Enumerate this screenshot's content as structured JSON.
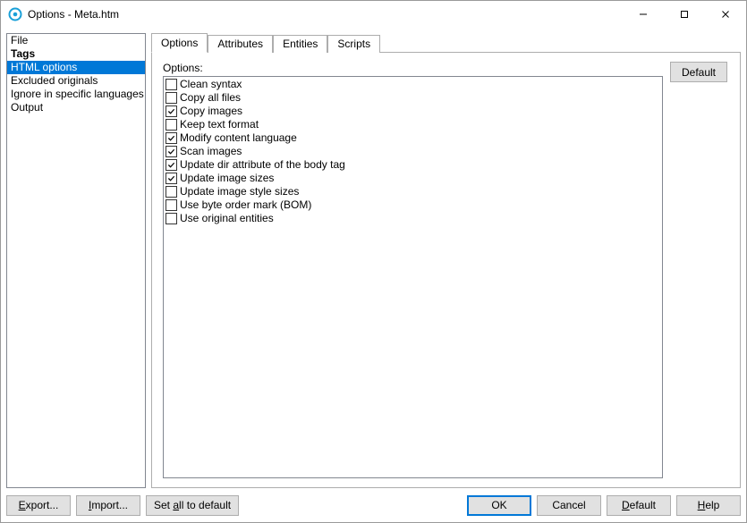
{
  "window": {
    "title": "Options - Meta.htm"
  },
  "sidebar": {
    "items": [
      {
        "label": "File",
        "bold": false,
        "selected": false
      },
      {
        "label": "Tags",
        "bold": true,
        "selected": false
      },
      {
        "label": "HTML options",
        "bold": false,
        "selected": true
      },
      {
        "label": "Excluded originals",
        "bold": false,
        "selected": false
      },
      {
        "label": "Ignore in specific languages",
        "bold": false,
        "selected": false
      },
      {
        "label": "Output",
        "bold": false,
        "selected": false
      }
    ]
  },
  "tabs": [
    {
      "label": "Options",
      "active": true
    },
    {
      "label": "Attributes",
      "active": false
    },
    {
      "label": "Entities",
      "active": false
    },
    {
      "label": "Scripts",
      "active": false
    }
  ],
  "options_panel": {
    "heading": "Options:",
    "default_button": "Default",
    "items": [
      {
        "label": "Clean syntax",
        "checked": false
      },
      {
        "label": "Copy all files",
        "checked": false
      },
      {
        "label": "Copy images",
        "checked": true
      },
      {
        "label": "Keep text format",
        "checked": false
      },
      {
        "label": "Modify content language",
        "checked": true
      },
      {
        "label": "Scan images",
        "checked": true
      },
      {
        "label": "Update dir attribute of the body tag",
        "checked": true
      },
      {
        "label": "Update image sizes",
        "checked": true
      },
      {
        "label": "Update image style sizes",
        "checked": false
      },
      {
        "label": "Use byte order mark (BOM)",
        "checked": false
      },
      {
        "label": "Use original entities",
        "checked": false
      }
    ]
  },
  "footer": {
    "export": "Export...",
    "import": "Import...",
    "set_all_default": "Set all to default",
    "ok": "OK",
    "cancel": "Cancel",
    "default": "Default",
    "help": "Help"
  }
}
